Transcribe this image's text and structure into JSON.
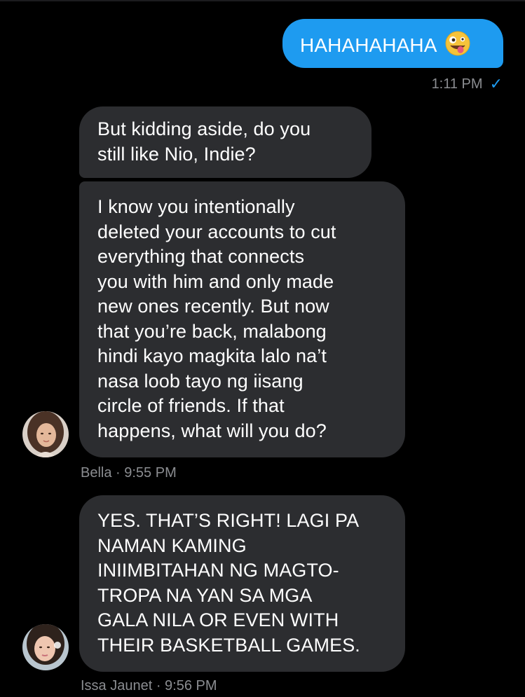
{
  "messages": {
    "outgoing_1": {
      "text": "HAHAHAHAHA",
      "emoji": "zany-face-emoji",
      "time": "1:11 PM",
      "status_icon": "✓"
    },
    "incoming_1": {
      "lines": [
        "But kidding aside, do you",
        "still like Nio, Indie?"
      ]
    },
    "incoming_2": {
      "lines": [
        "I know you intentionally",
        "deleted your accounts to cut",
        "everything that connects",
        "you with him and only made",
        "new ones recently. But now",
        "that you’re back, malabong",
        "hindi kayo magkita lalo na’t",
        "nasa loob tayo ng iisang",
        "circle of friends. If that",
        "happens, what will you do?"
      ],
      "meta": "Bella · 9:55 PM"
    },
    "incoming_3": {
      "lines": [
        "YES. THAT’S RIGHT! LAGI PA",
        "NAMAN KAMING",
        "INIIMBITAHAN NG MAGTO-",
        "TROPA NA YAN SA MGA",
        "GALA NILA OR EVEN WITH",
        "THEIR BASKETBALL GAMES."
      ],
      "meta": "Issa Jaunet · 9:56 PM"
    }
  },
  "colors": {
    "background": "#000000",
    "outgoing_bubble": "#1e9bf0",
    "incoming_bubble": "#2c2d30",
    "meta_text": "#8b8d91"
  }
}
